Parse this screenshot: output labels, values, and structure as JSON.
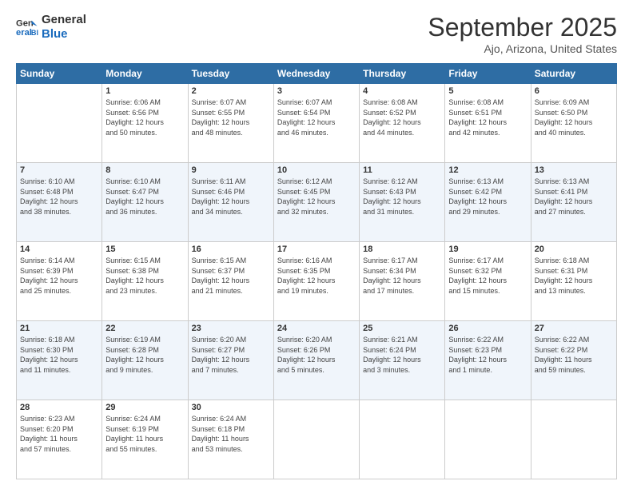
{
  "header": {
    "logo_line1": "General",
    "logo_line2": "Blue",
    "month": "September 2025",
    "location": "Ajo, Arizona, United States"
  },
  "weekdays": [
    "Sunday",
    "Monday",
    "Tuesday",
    "Wednesday",
    "Thursday",
    "Friday",
    "Saturday"
  ],
  "weeks": [
    [
      {
        "day": "",
        "info": ""
      },
      {
        "day": "1",
        "info": "Sunrise: 6:06 AM\nSunset: 6:56 PM\nDaylight: 12 hours\nand 50 minutes."
      },
      {
        "day": "2",
        "info": "Sunrise: 6:07 AM\nSunset: 6:55 PM\nDaylight: 12 hours\nand 48 minutes."
      },
      {
        "day": "3",
        "info": "Sunrise: 6:07 AM\nSunset: 6:54 PM\nDaylight: 12 hours\nand 46 minutes."
      },
      {
        "day": "4",
        "info": "Sunrise: 6:08 AM\nSunset: 6:52 PM\nDaylight: 12 hours\nand 44 minutes."
      },
      {
        "day": "5",
        "info": "Sunrise: 6:08 AM\nSunset: 6:51 PM\nDaylight: 12 hours\nand 42 minutes."
      },
      {
        "day": "6",
        "info": "Sunrise: 6:09 AM\nSunset: 6:50 PM\nDaylight: 12 hours\nand 40 minutes."
      }
    ],
    [
      {
        "day": "7",
        "info": "Sunrise: 6:10 AM\nSunset: 6:48 PM\nDaylight: 12 hours\nand 38 minutes."
      },
      {
        "day": "8",
        "info": "Sunrise: 6:10 AM\nSunset: 6:47 PM\nDaylight: 12 hours\nand 36 minutes."
      },
      {
        "day": "9",
        "info": "Sunrise: 6:11 AM\nSunset: 6:46 PM\nDaylight: 12 hours\nand 34 minutes."
      },
      {
        "day": "10",
        "info": "Sunrise: 6:12 AM\nSunset: 6:45 PM\nDaylight: 12 hours\nand 32 minutes."
      },
      {
        "day": "11",
        "info": "Sunrise: 6:12 AM\nSunset: 6:43 PM\nDaylight: 12 hours\nand 31 minutes."
      },
      {
        "day": "12",
        "info": "Sunrise: 6:13 AM\nSunset: 6:42 PM\nDaylight: 12 hours\nand 29 minutes."
      },
      {
        "day": "13",
        "info": "Sunrise: 6:13 AM\nSunset: 6:41 PM\nDaylight: 12 hours\nand 27 minutes."
      }
    ],
    [
      {
        "day": "14",
        "info": "Sunrise: 6:14 AM\nSunset: 6:39 PM\nDaylight: 12 hours\nand 25 minutes."
      },
      {
        "day": "15",
        "info": "Sunrise: 6:15 AM\nSunset: 6:38 PM\nDaylight: 12 hours\nand 23 minutes."
      },
      {
        "day": "16",
        "info": "Sunrise: 6:15 AM\nSunset: 6:37 PM\nDaylight: 12 hours\nand 21 minutes."
      },
      {
        "day": "17",
        "info": "Sunrise: 6:16 AM\nSunset: 6:35 PM\nDaylight: 12 hours\nand 19 minutes."
      },
      {
        "day": "18",
        "info": "Sunrise: 6:17 AM\nSunset: 6:34 PM\nDaylight: 12 hours\nand 17 minutes."
      },
      {
        "day": "19",
        "info": "Sunrise: 6:17 AM\nSunset: 6:32 PM\nDaylight: 12 hours\nand 15 minutes."
      },
      {
        "day": "20",
        "info": "Sunrise: 6:18 AM\nSunset: 6:31 PM\nDaylight: 12 hours\nand 13 minutes."
      }
    ],
    [
      {
        "day": "21",
        "info": "Sunrise: 6:18 AM\nSunset: 6:30 PM\nDaylight: 12 hours\nand 11 minutes."
      },
      {
        "day": "22",
        "info": "Sunrise: 6:19 AM\nSunset: 6:28 PM\nDaylight: 12 hours\nand 9 minutes."
      },
      {
        "day": "23",
        "info": "Sunrise: 6:20 AM\nSunset: 6:27 PM\nDaylight: 12 hours\nand 7 minutes."
      },
      {
        "day": "24",
        "info": "Sunrise: 6:20 AM\nSunset: 6:26 PM\nDaylight: 12 hours\nand 5 minutes."
      },
      {
        "day": "25",
        "info": "Sunrise: 6:21 AM\nSunset: 6:24 PM\nDaylight: 12 hours\nand 3 minutes."
      },
      {
        "day": "26",
        "info": "Sunrise: 6:22 AM\nSunset: 6:23 PM\nDaylight: 12 hours\nand 1 minute."
      },
      {
        "day": "27",
        "info": "Sunrise: 6:22 AM\nSunset: 6:22 PM\nDaylight: 11 hours\nand 59 minutes."
      }
    ],
    [
      {
        "day": "28",
        "info": "Sunrise: 6:23 AM\nSunset: 6:20 PM\nDaylight: 11 hours\nand 57 minutes."
      },
      {
        "day": "29",
        "info": "Sunrise: 6:24 AM\nSunset: 6:19 PM\nDaylight: 11 hours\nand 55 minutes."
      },
      {
        "day": "30",
        "info": "Sunrise: 6:24 AM\nSunset: 6:18 PM\nDaylight: 11 hours\nand 53 minutes."
      },
      {
        "day": "",
        "info": ""
      },
      {
        "day": "",
        "info": ""
      },
      {
        "day": "",
        "info": ""
      },
      {
        "day": "",
        "info": ""
      }
    ]
  ]
}
